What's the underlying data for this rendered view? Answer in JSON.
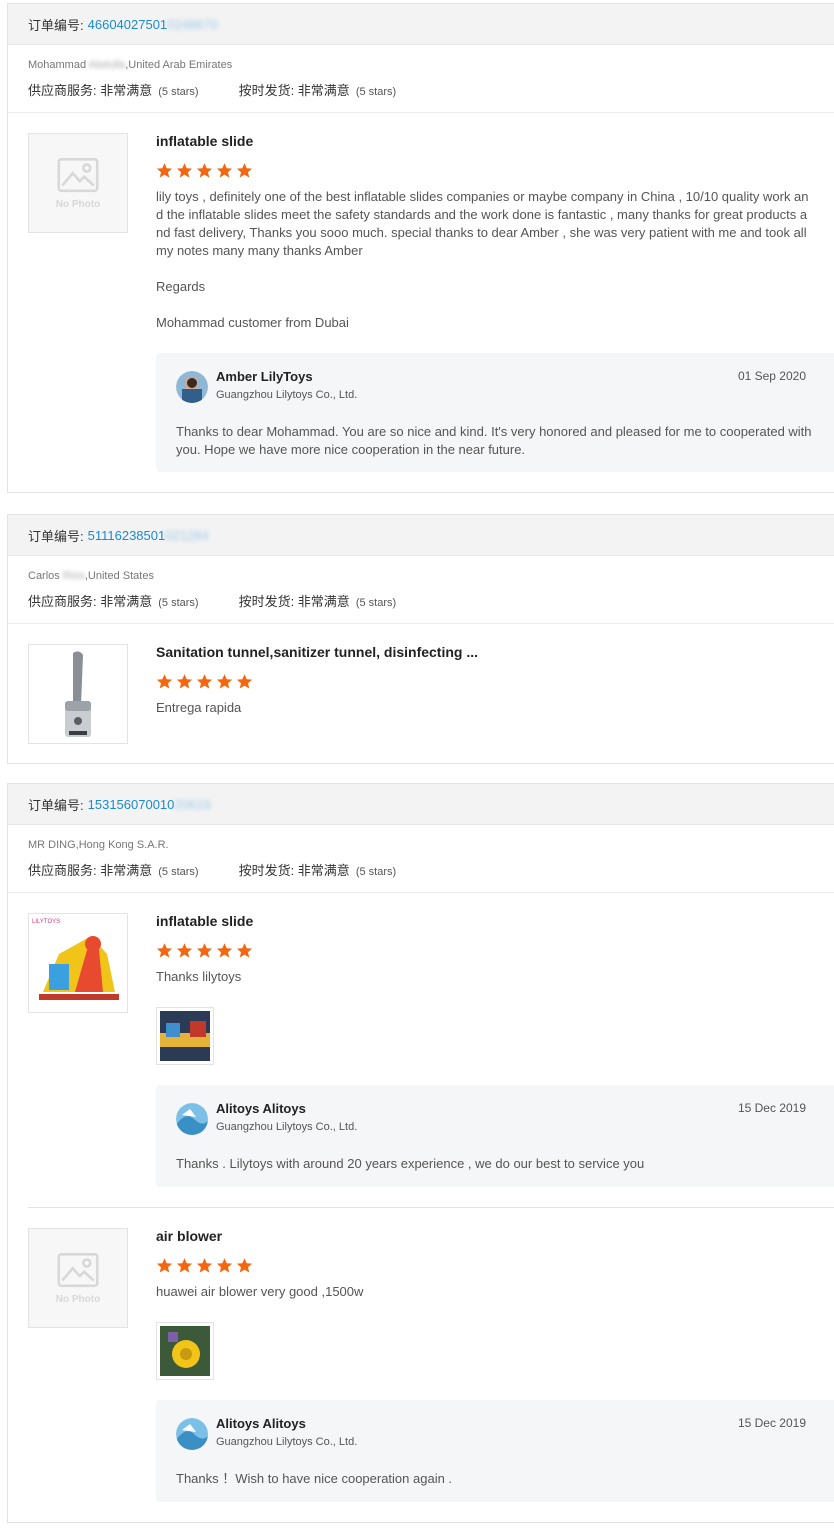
{
  "cards": [
    {
      "order_label": "订单编号:",
      "order_no": "46604027501",
      "order_no_blurred": "0248670",
      "buyer_name": "Mohammad",
      "buyer_name_blurred": "Abdulla",
      "buyer_country": ",United Arab Emirates",
      "service_label": "供应商服务: 非常满意",
      "service_stars": "(5 stars)",
      "shipping_label": "按时发货: 非常满意",
      "shipping_stars": "(5 stars)",
      "products": [
        {
          "thumb_text": "No Photo",
          "title": "inflatable slide",
          "rating": 5,
          "review": [
            "lily toys , definitely one of the best inflatable slides companies or maybe company in China , 10/10 quality work and the inflatable slides meet the safety standards and the work done is fantastic , many thanks for great products and fast delivery,  Thanks you sooo much. special thanks to dear Amber , she was very patient with me and took all my notes many many thanks Amber",
            "Regards",
            "Mohammad customer from Dubai"
          ],
          "reply": {
            "name": "Amber LilyToys",
            "company": "Guangzhou Lilytoys Co., Ltd.",
            "date": "01 Sep 2020",
            "text": "Thanks to dear Mohammad. You are so nice and kind.  It's very honored and pleased for me to cooperated with you. Hope we have more nice cooperation in the near future."
          }
        }
      ]
    },
    {
      "order_label": "订单编号:",
      "order_no": "51116238501",
      "order_no_blurred": "021284",
      "buyer_name": "Carlos",
      "buyer_name_blurred": "Rios",
      "buyer_country": ",United States",
      "service_label": "供应商服务: 非常满意",
      "service_stars": "(5 stars)",
      "shipping_label": "按时发货: 非常满意",
      "shipping_stars": "(5 stars)",
      "products": [
        {
          "title": "Sanitation tunnel,sanitizer tunnel, disinfecting ...",
          "rating": 5,
          "review": [
            "Entrega rapida"
          ]
        }
      ]
    },
    {
      "order_label": "订单编号:",
      "order_no": "153156070010",
      "order_no_blurred": "20619",
      "buyer_name": "MR DING",
      "buyer_name_blurred": "",
      "buyer_country": ",Hong Kong S.A.R.",
      "service_label": "供应商服务: 非常满意",
      "service_stars": "(5 stars)",
      "shipping_label": "按时发货: 非常满意",
      "shipping_stars": "(5 stars)",
      "products": [
        {
          "thumb_logo": "LILYTOYS",
          "title": "inflatable slide",
          "rating": 5,
          "review": [
            "Thanks lilytoys"
          ],
          "reply": {
            "name": "Alitoys Alitoys",
            "company": "Guangzhou Lilytoys Co., Ltd.",
            "date": "15 Dec 2019",
            "text": "Thanks . Lilytoys with around 20 years experience , we do our best to service you"
          }
        },
        {
          "thumb_text": "No Photo",
          "title": "air blower",
          "rating": 5,
          "review": [
            "huawei air blower very good ,1500w"
          ],
          "reply": {
            "name": "Alitoys Alitoys",
            "company": "Guangzhou Lilytoys Co., Ltd.",
            "date": "15 Dec 2019",
            "text": "Thanks ！Wish to have nice cooperation again ."
          }
        }
      ]
    }
  ],
  "colors": {
    "star": "#f5660f",
    "order_link": "#1b8ad4",
    "header_bg": "#f3f3f3",
    "reply_bg": "#f5f6f8"
  },
  "icons": {
    "star": "star-icon",
    "no_photo": "image-placeholder-icon",
    "avatar": "user-avatar"
  }
}
